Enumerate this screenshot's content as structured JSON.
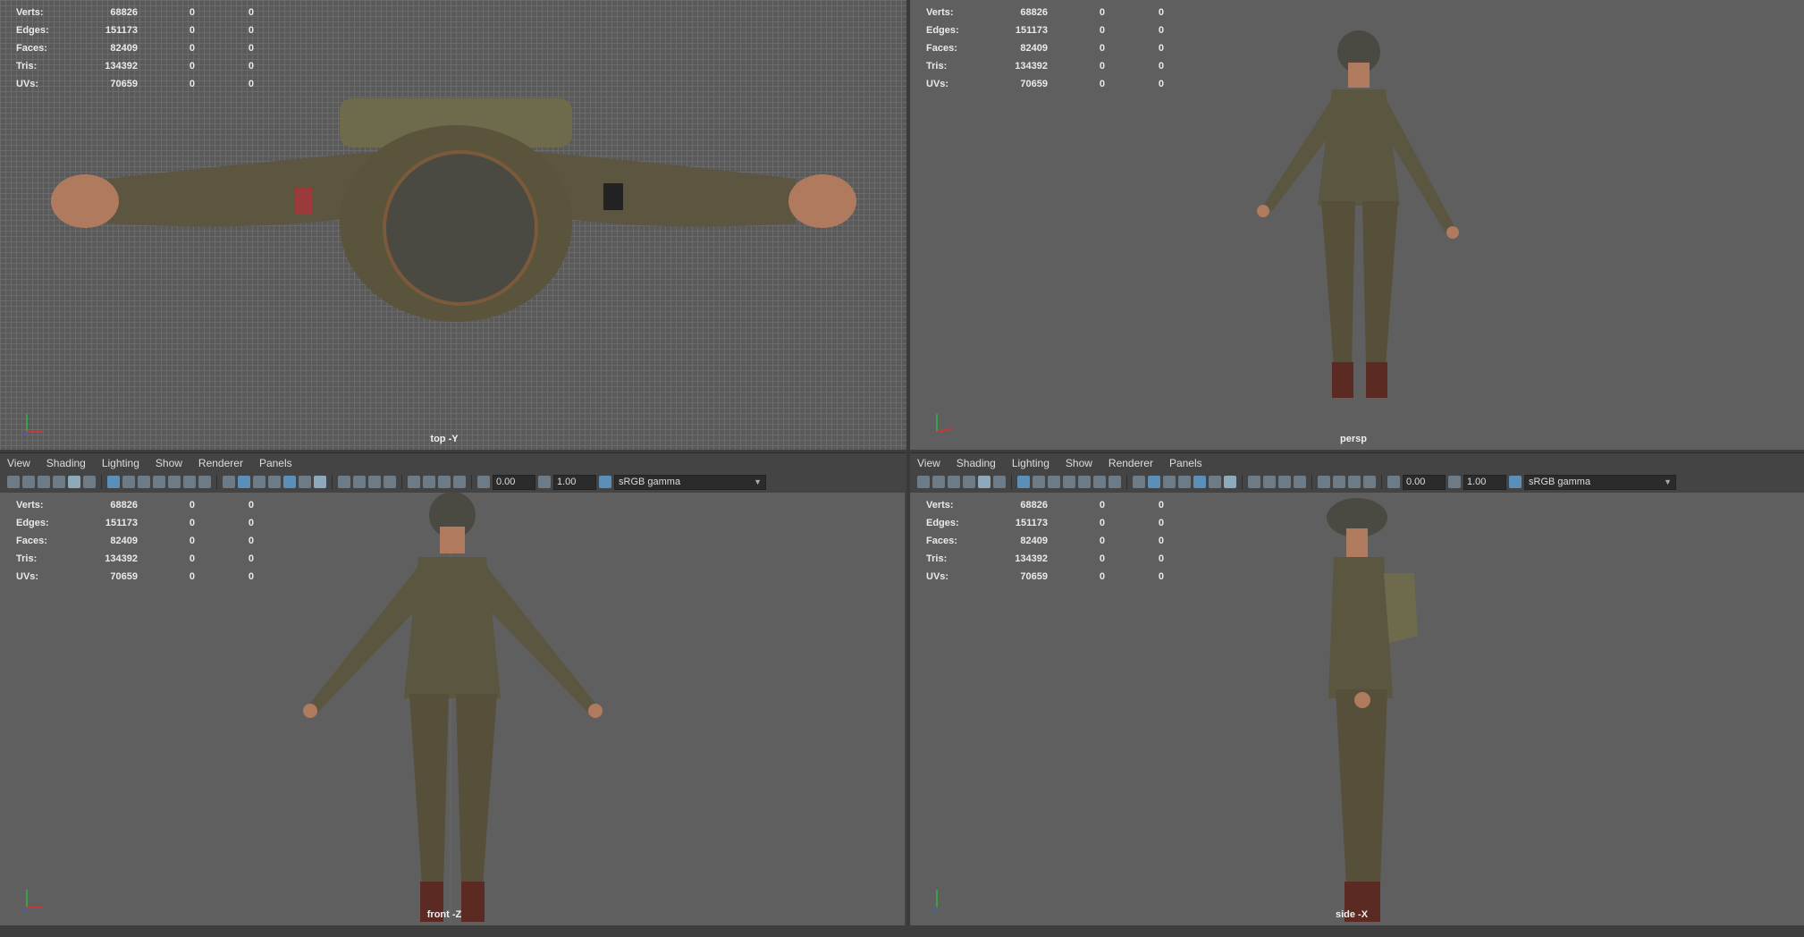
{
  "stats": [
    {
      "label": "Verts:",
      "v1": "68826",
      "v2": "0",
      "v3": "0"
    },
    {
      "label": "Edges:",
      "v1": "151173",
      "v2": "0",
      "v3": "0"
    },
    {
      "label": "Faces:",
      "v1": "82409",
      "v2": "0",
      "v3": "0"
    },
    {
      "label": "Tris:",
      "v1": "134392",
      "v2": "0",
      "v3": "0"
    },
    {
      "label": "UVs:",
      "v1": "70659",
      "v2": "0",
      "v3": "0"
    }
  ],
  "cameras": {
    "top": "top -Y",
    "persp": "persp",
    "front": "front -Z",
    "side": "side -X"
  },
  "menu": [
    "View",
    "Shading",
    "Lighting",
    "Show",
    "Renderer",
    "Panels"
  ],
  "toolbar": {
    "exposure": "0.00",
    "gamma_value": "1.00",
    "color_space": "sRGB gamma"
  },
  "colors": {
    "uniform": "#5b5640",
    "skin": "#b07a5e",
    "helmet": "#4b4a42",
    "boots": "#5b2a22"
  }
}
